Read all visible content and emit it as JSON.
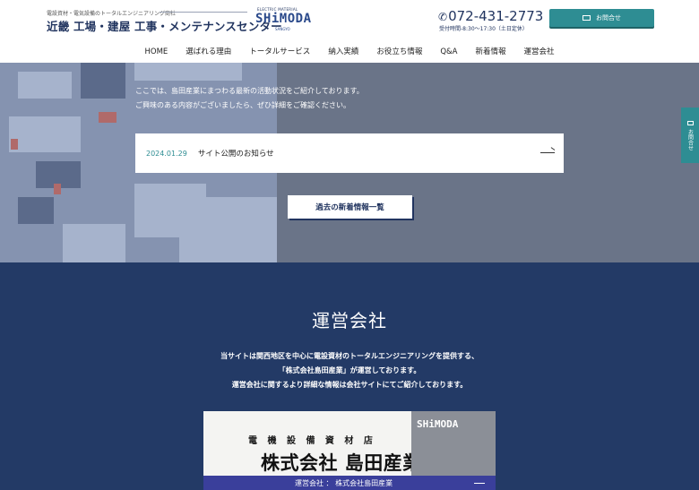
{
  "header": {
    "tagline": "電設資材・電気設備のトータルエンジニアリング商社",
    "site_title": "近畿 工場・建屋 工事・メンテナンスセンター",
    "logo_small": "ELECTRIC MATERIAL",
    "logo_text": "SHiMODA",
    "logo_sub": "SANGYO",
    "phone": "072-431-2773",
    "hours": "受付時間-8:30〜17:30（土日定休）",
    "contact_label": "お問合せ"
  },
  "nav": {
    "items": [
      "HOME",
      "選ばれる理由",
      "トータルサービス",
      "納入実績",
      "お役立ち情報",
      "Q&A",
      "新着情報",
      "運営会社"
    ]
  },
  "news": {
    "intro_line1": "ここでは、島田産業にまつわる最新の活動状況をご紹介しております。",
    "intro_line2": "ご興味のある内容がございましたら、ぜひ詳細をご確認ください。",
    "item_date": "2024.01.29",
    "item_title": "サイト公開のお知らせ",
    "archive_label": "過去の新着情報一覧"
  },
  "side_tab": {
    "label": "お問合せ"
  },
  "company": {
    "title": "運営会社",
    "desc_line1": "当サイトは関西地区を中心に電設資材のトータルエンジニアリングを提供する、",
    "desc_line2": "「株式会社島田産業」が運営しております。",
    "desc_line3": "運営会社に関するより詳細な情報は会社サイトにてご紹介しております。",
    "truck_small": "電 機 設 備 資 材 店",
    "truck_big": "株式会社 島田産業",
    "photo_logo": "SHiMODA",
    "photo_caption": "運営会社 ： 株式会社島田産業"
  },
  "colors": {
    "navy": "#21345f",
    "teal": "#2e8d93",
    "section_blue": "#233a66"
  }
}
